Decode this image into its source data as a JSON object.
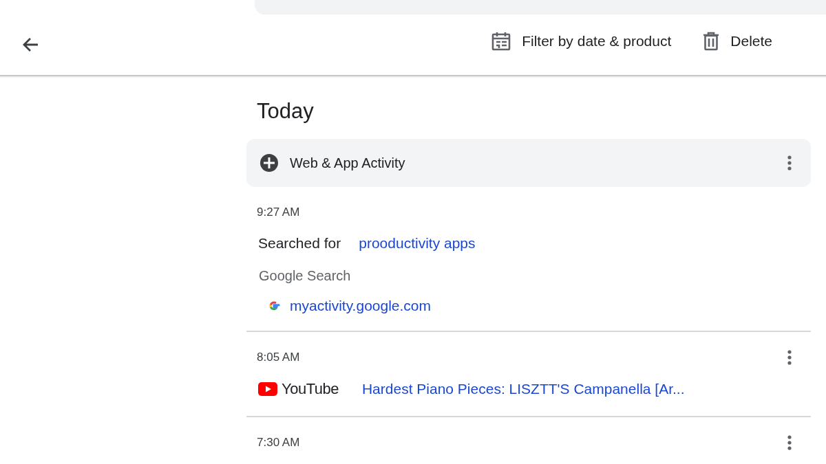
{
  "toolbar": {
    "actions": [
      {
        "kind": "filter",
        "label": "Filter by date & product"
      },
      {
        "kind": "delete",
        "label": "Delete"
      }
    ]
  },
  "day": {
    "title": "Today",
    "group": {
      "title": "Web & App Activity"
    },
    "entries": [
      {
        "kind": "search",
        "time": "9:27 AM",
        "action": "Searched for",
        "query": "prooductivity apps",
        "product": "Google Search",
        "source": "myactivity.google.com"
      },
      {
        "kind": "video",
        "time": "8:05 AM",
        "product": "YouTube",
        "title": "Hardest Piano Pieces: LISZTT'S Campanella [Ar..."
      },
      {
        "kind": "partial",
        "time": "7:30 AM"
      }
    ]
  }
}
